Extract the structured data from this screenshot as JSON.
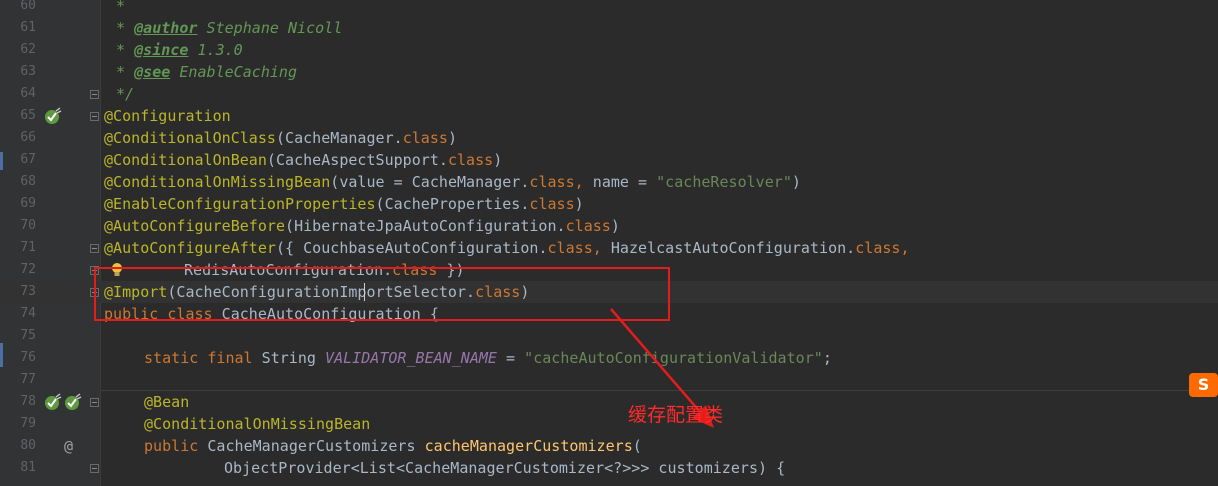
{
  "editor": {
    "line_numbers": [
      "60",
      "61",
      "62",
      "63",
      "64",
      "65",
      "66",
      "67",
      "68",
      "69",
      "70",
      "71",
      "72",
      "73",
      "74",
      "75",
      "76",
      "77",
      "78",
      "79",
      "80",
      "81"
    ]
  },
  "code": {
    "l60": {
      "t1": "*"
    },
    "l61": {
      "t1": "* ",
      "tag": "@author",
      "t2": " Stephane Nicoll"
    },
    "l62": {
      "t1": "* ",
      "tag": "@since",
      "t2": " 1.3.0"
    },
    "l63": {
      "t1": "* ",
      "tag": "@see",
      "t2": " EnableCaching"
    },
    "l64": {
      "t1": "*/"
    },
    "l65": {
      "a1": "@Configuration"
    },
    "l66": {
      "a1": "@ConditionalOnClass",
      "p1": "(CacheManager.",
      "k1": "class",
      "p2": ")"
    },
    "l67": {
      "a1": "@ConditionalOnBean",
      "p1": "(CacheAspectSupport.",
      "k1": "class",
      "p2": ")"
    },
    "l68": {
      "a1": "@ConditionalOnMissingBean",
      "p1": "(value = CacheManager.",
      "k1": "class,",
      "p2": " name = ",
      "s1": "\"cacheResolver\"",
      "p3": ")"
    },
    "l69": {
      "a1": "@EnableConfigurationProperties",
      "p1": "(CacheProperties.",
      "k1": "class",
      "p2": ")"
    },
    "l70": {
      "a1": "@AutoConfigureBefore",
      "p1": "(HibernateJpaAutoConfiguration.",
      "k1": "class",
      "p2": ")"
    },
    "l71": {
      "a1": "@AutoConfigureAfter",
      "p1": "({ CouchbaseAutoConfiguration.",
      "k1": "class,",
      "p2": " HazelcastAutoConfiguration.",
      "k2": "class,"
    },
    "l72": {
      "p1": "RedisAutoConfiguration.",
      "k1": "class",
      "p2": " })"
    },
    "l73": {
      "a1": "@Import",
      "p1": "(CacheConfigurationImportSelector.",
      "k1": "class",
      "p2": ")"
    },
    "l74": {
      "k1": "public class",
      "p1": " CacheAutoConfiguration {"
    },
    "l76": {
      "k1": "static final",
      "p1": " String ",
      "c1": "VALIDATOR_BEAN_NAME",
      "p2": " = ",
      "s1": "\"cacheAutoConfigurationValidator\"",
      "p3": ";"
    },
    "l78": {
      "a1": "@Bean"
    },
    "l79": {
      "a1": "@ConditionalOnMissingBean"
    },
    "l80": {
      "k1": "public",
      "p1": " CacheManagerCustomizers ",
      "f1": "cacheManagerCustomizers",
      "p2": "("
    },
    "l81": {
      "p1": "ObjectProvider<List<CacheManagerCustomizer<?>>> customizers) {"
    }
  },
  "annotation_overlay": {
    "callout_text": "缓存配置类",
    "color": "#e51c1c"
  },
  "icons": {
    "bean_icon": "spring-bean-icon",
    "lightbulb": "lightbulb-icon",
    "override": "override-at-icon",
    "ime": "sogou-ime-icon"
  },
  "sogou_label": "S"
}
